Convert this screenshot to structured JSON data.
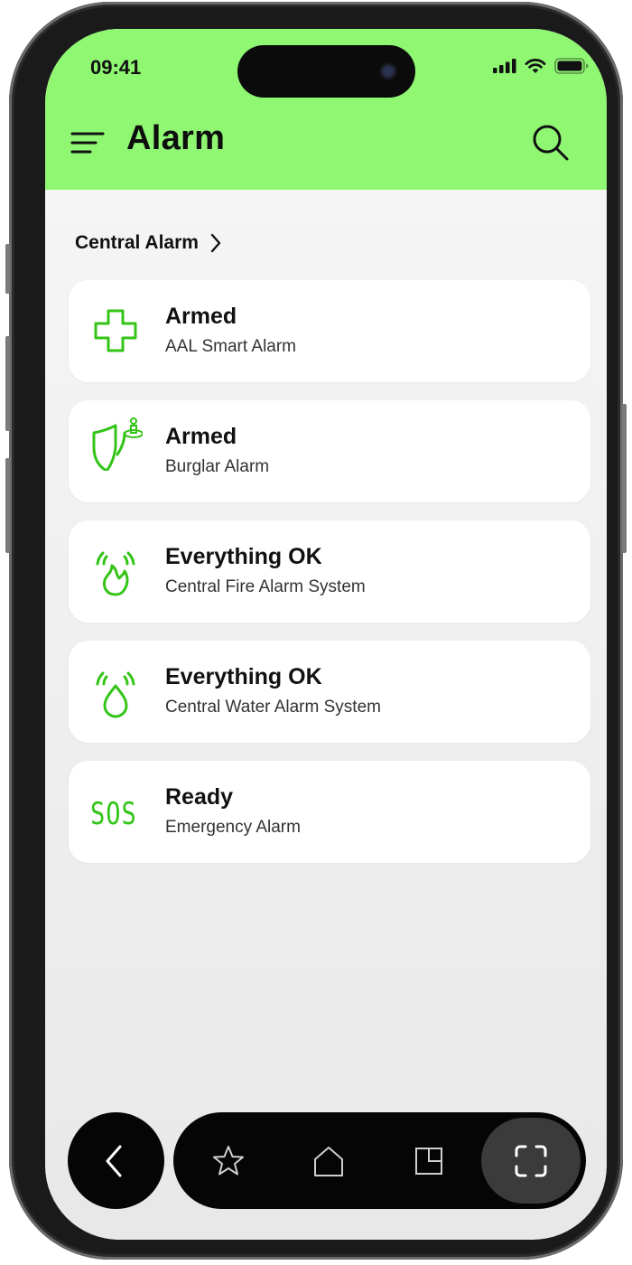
{
  "status_bar": {
    "time": "09:41"
  },
  "header": {
    "title": "Alarm"
  },
  "section": {
    "title": "Central Alarm"
  },
  "alarms": [
    {
      "status": "Armed",
      "name": "AAL Smart Alarm",
      "icon": "medical-cross-icon"
    },
    {
      "status": "Armed",
      "name": "Burglar Alarm",
      "icon": "shield-person-icon"
    },
    {
      "status": "Everything OK",
      "name": "Central Fire Alarm System",
      "icon": "fire-alarm-icon"
    },
    {
      "status": "Everything OK",
      "name": "Central Water Alarm System",
      "icon": "water-alarm-icon"
    },
    {
      "status": "Ready",
      "name": "Emergency Alarm",
      "icon": "sos-icon",
      "icon_text": "SOS"
    }
  ],
  "bottom_nav": {
    "items": [
      "back-icon",
      "favorites-star-icon",
      "home-icon",
      "rooms-icon",
      "scan-icon"
    ],
    "active": "scan-icon"
  },
  "colors": {
    "accent": "#8ff772",
    "icon_green": "#34c418",
    "nav_bg": "#050505"
  }
}
